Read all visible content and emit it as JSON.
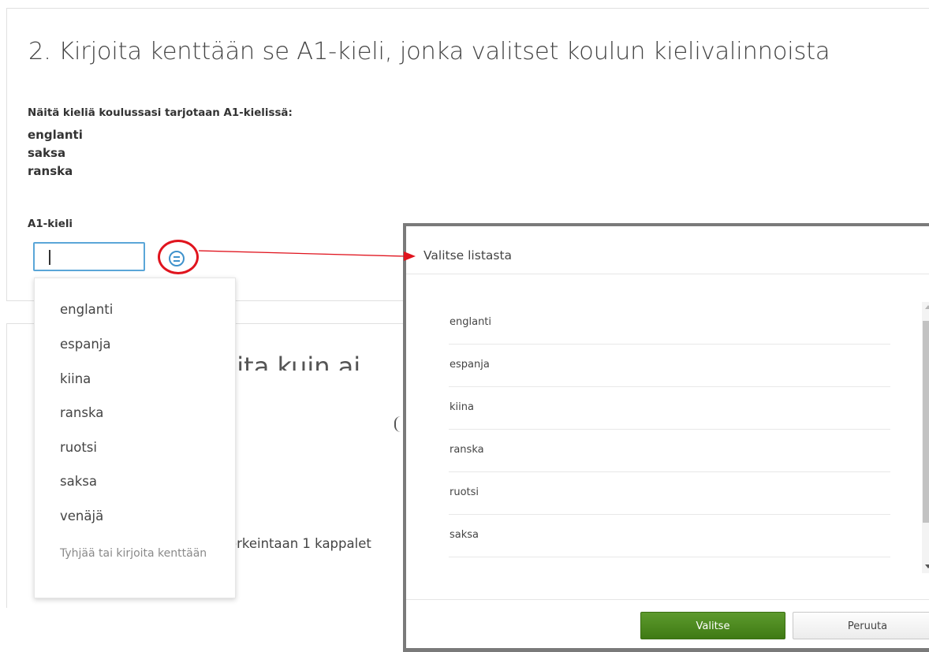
{
  "question": {
    "heading": "2. Kirjoita kenttään se A1-kieli, jonka valitset koulun kielivalinnoista",
    "intro": "Näitä kieliä koulussasi tarjotaan A1-kielissä:",
    "offered_languages": [
      "englanti",
      "saksa",
      "ranska"
    ],
    "field_label": "A1-kieli",
    "input_value": ""
  },
  "dropdown": {
    "items": [
      "englanti",
      "espanja",
      "kiina",
      "ranska",
      "ruotsi",
      "saksa",
      "venäjä"
    ],
    "hint": "Tyhjää tai kirjoita kenttään"
  },
  "background": {
    "partial_heading": "uita kuin ai",
    "partial_text": "orkeintaan 1 kappalet"
  },
  "modal": {
    "title": "Valitse listasta",
    "items": [
      "englanti",
      "espanja",
      "kiina",
      "ranska",
      "ruotsi",
      "saksa"
    ],
    "select_button": "Valitse",
    "cancel_button": "Peruuta"
  },
  "colors": {
    "annotation_red": "#e0141e",
    "input_focus_blue": "#5aa6d8",
    "primary_green": "#4a8a1f"
  },
  "icons": {
    "list_button": "list-circle-icon"
  }
}
